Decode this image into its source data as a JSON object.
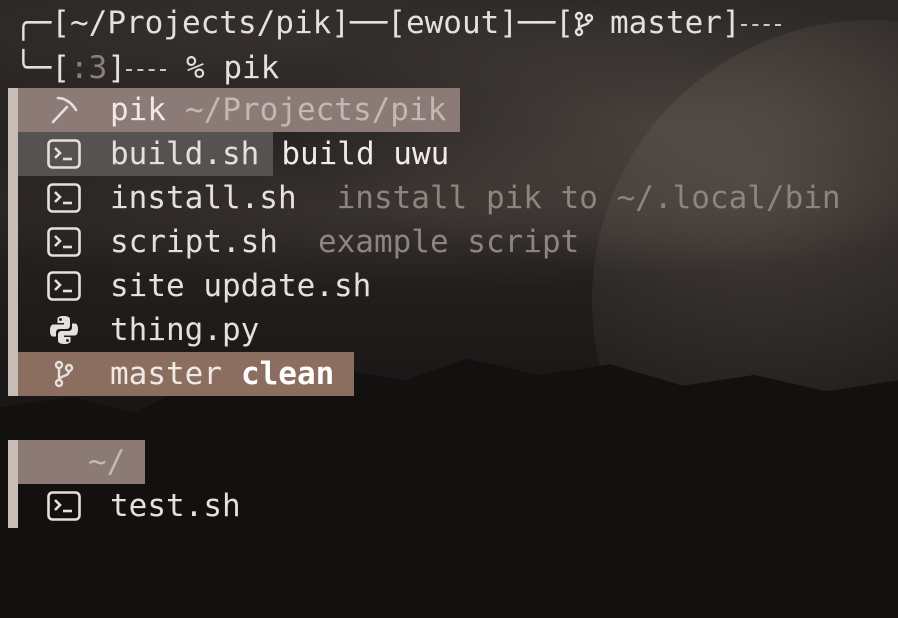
{
  "prompt": {
    "line1_open": "╭─[",
    "cwd": "~/Projects/pik",
    "sep1": "]──[",
    "user": "ewout",
    "sep2": "]──[",
    "branch": "master",
    "close1": "]",
    "line2_open": "╰─[",
    "code": ":3",
    "close2": "]",
    "symbol": "%",
    "command": "pik"
  },
  "groups": [
    {
      "header": {
        "icon": "pickaxe-icon",
        "name": "pik",
        "path": "~/Projects/pik"
      },
      "items": [
        {
          "icon": "terminal-icon",
          "label": "build.sh",
          "desc": "build uwu",
          "selected": true
        },
        {
          "icon": "terminal-icon",
          "label": "install.sh",
          "desc": "install pik to ~/.local/bin",
          "selected": false
        },
        {
          "icon": "terminal-icon",
          "label": "script.sh",
          "desc": "example script",
          "selected": false
        },
        {
          "icon": "terminal-icon",
          "label": "site update.sh",
          "desc": "",
          "selected": false
        },
        {
          "icon": "python-icon",
          "label": "thing.py",
          "desc": "",
          "selected": false
        }
      ],
      "git": {
        "icon": "git-branch-icon",
        "branch": "master",
        "status": "clean"
      }
    },
    {
      "header": {
        "path": "~/"
      },
      "items": [
        {
          "icon": "terminal-icon",
          "label": "test.sh"
        }
      ]
    }
  ],
  "colors": {
    "header_bg": "#8b7a76",
    "selected_bg": "#555352",
    "git_bg": "#8c6e60",
    "bar_bg": "#c8bcb6",
    "text": "#e6e0dc",
    "muted": "#8c847f"
  }
}
